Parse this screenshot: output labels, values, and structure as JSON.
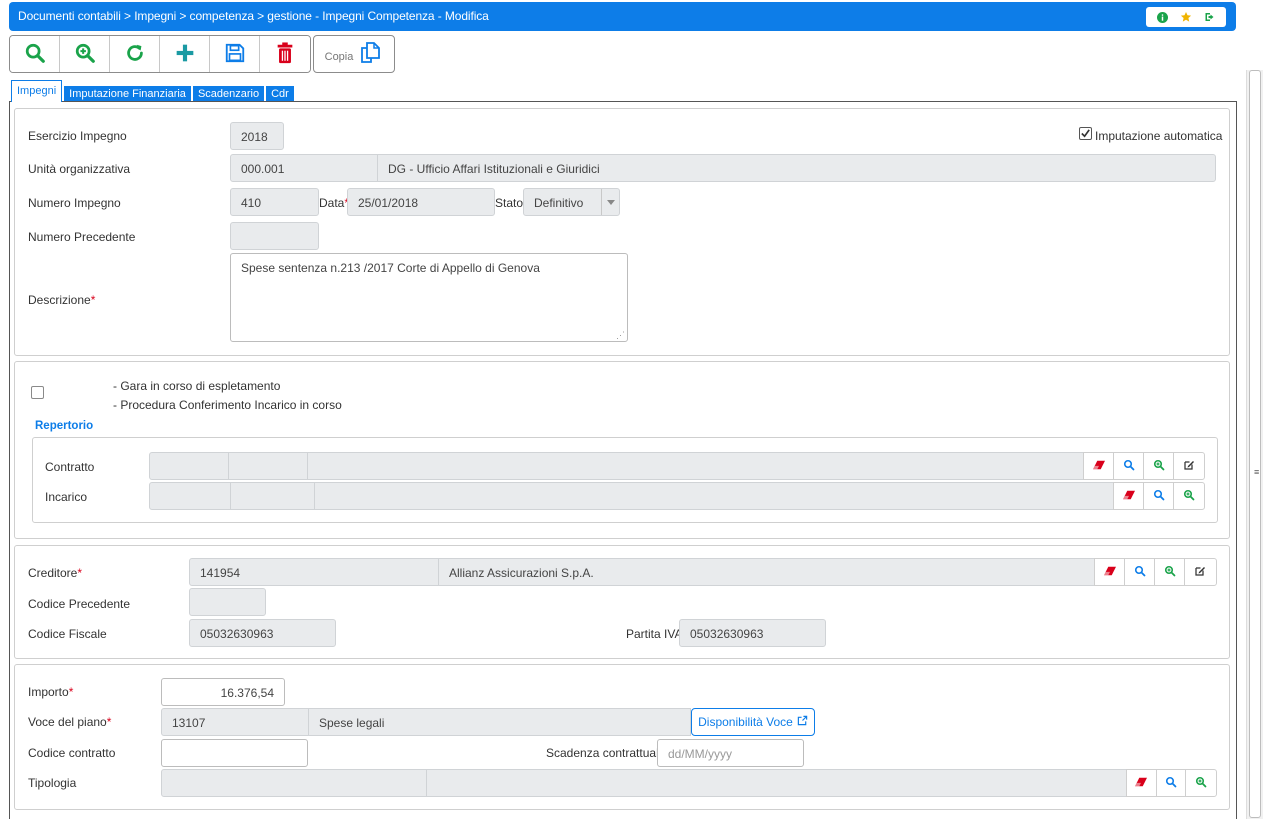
{
  "titlebar": {
    "breadcrumb": "Documenti contabili > Impegni > competenza > gestione - Impegni Competenza - Modifica",
    "icons": [
      "info-icon",
      "star-icon",
      "logout-icon"
    ]
  },
  "toolbar": {
    "icons": [
      "search-icon",
      "zoom-in-icon",
      "refresh-icon",
      "plus-icon",
      "save-icon",
      "trash-icon"
    ],
    "copy_label": "Copia"
  },
  "tabs": [
    {
      "label": "Impegni",
      "active": true
    },
    {
      "label": "Imputazione Finanziaria",
      "active": false
    },
    {
      "label": "Scadenzario",
      "active": false
    },
    {
      "label": "Cdr",
      "active": false
    }
  ],
  "impegno": {
    "esercizio_label": "Esercizio Impegno",
    "esercizio_value": "2018",
    "imputazione_label": "Imputazione automatica",
    "imputazione_checked": true,
    "unita_label": "Unità organizzativa",
    "unita_code": "000.001",
    "unita_desc": "DG - Ufficio Affari Istituzionali e Giuridici",
    "numero_label": "Numero Impegno",
    "numero_value": "410",
    "data_label": "Data",
    "data_value": "25/01/2018",
    "stato_label": "Stato",
    "stato_value": "Definitivo",
    "precedente_label": "Numero Precedente",
    "precedente_value": "",
    "descrizione_label": "Descrizione",
    "descrizione_value": "Spese sentenza  n.213 /2017  Corte di Appello di Genova"
  },
  "gara": {
    "checked": false,
    "line1": "- Gara in corso di espletamento",
    "line2": "- Procedura Conferimento Incarico in corso",
    "repertorio_title": "Repertorio",
    "contratto_label": "Contratto",
    "incarico_label": "Incarico"
  },
  "creditore": {
    "label": "Creditore",
    "code": "141954",
    "name": "Allianz  Assicurazioni S.p.A.",
    "codice_precedente_label": "Codice Precedente",
    "codice_precedente_value": "",
    "codice_fiscale_label": "Codice Fiscale",
    "codice_fiscale_value": "05032630963",
    "partita_iva_label": "Partita IVA",
    "partita_iva_value": "05032630963"
  },
  "importo": {
    "importo_label": "Importo",
    "importo_value": "16.376,54",
    "voce_label": "Voce del piano",
    "voce_code": "13107",
    "voce_desc": "Spese legali",
    "disponibilita_label": "Disponibilità Voce",
    "codice_contratto_label": "Codice contratto",
    "codice_contratto_value": "",
    "scadenza_label": "Scadenza contrattuale",
    "scadenza_placeholder": "dd/MM/yyyy",
    "tipologia_label": "Tipologia"
  },
  "colors": {
    "accent": "#0d7de8",
    "green": "#1aa34a",
    "red": "#d9001b",
    "field_bg": "#e9ebed"
  }
}
